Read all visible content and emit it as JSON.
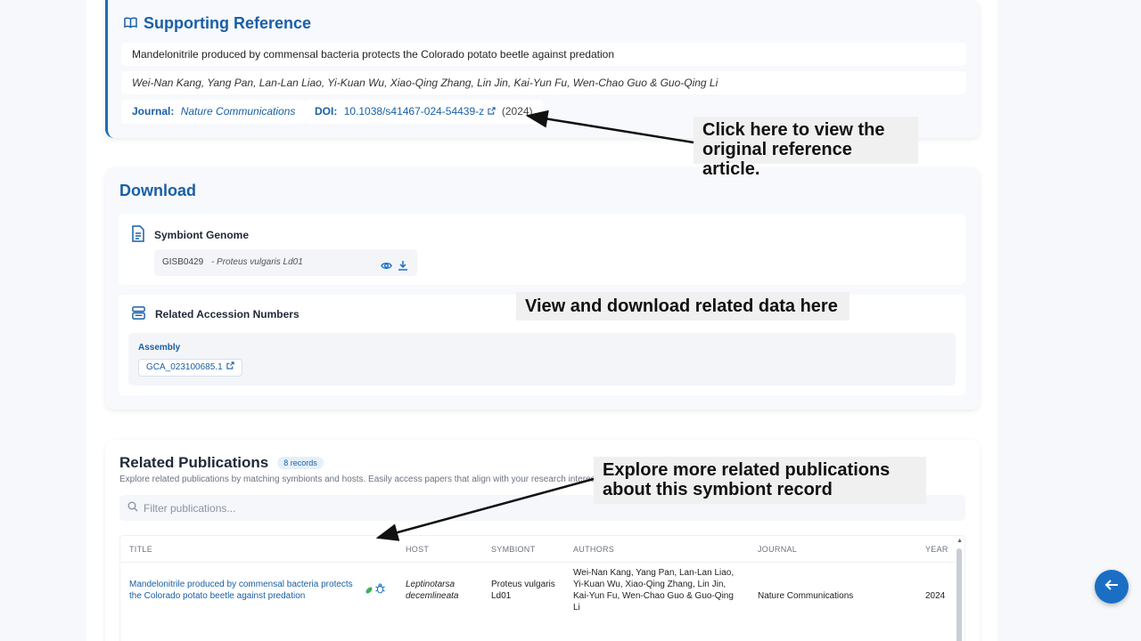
{
  "reference": {
    "heading": "Supporting Reference",
    "title": "Mandelonitrile produced by commensal bacteria protects the Colorado potato beetle against predation",
    "authors": "Wei-Nan Kang, Yang Pan, Lan-Lan Liao, Yi-Kuan Wu, Xiao-Qing Zhang, Lin Jin, Kai-Yun Fu, Wen-Chao Guo & Guo-Qing Li",
    "journal_label": "Journal:",
    "journal": "Nature Communications",
    "doi_label": "DOI:",
    "doi": "10.1038/s41467-024-54439-z",
    "year": "(2024)"
  },
  "download": {
    "heading": "Download",
    "genome": {
      "label": "Symbiont Genome",
      "id": "GISB0429",
      "name": "- Proteus vulgaris Ld01"
    },
    "accessions": {
      "label": "Related Accession Numbers",
      "assembly_label": "Assembly",
      "assembly_id": "GCA_023100685.1"
    }
  },
  "publications": {
    "heading": "Related Publications",
    "badge": "8 records",
    "description": "Explore related publications by matching symbionts and hosts. Easily access papers that align with your research interests.",
    "filter_placeholder": "Filter publications...",
    "columns": [
      "TITLE",
      "HOST",
      "SYMBIONT",
      "AUTHORS",
      "JOURNAL",
      "YEAR"
    ],
    "rows": [
      {
        "title": "Mandelonitrile produced by commensal bacteria protects the Colorado potato beetle against predation",
        "host": "Leptinotarsa decemlineata",
        "symbiont": "Proteus vulgaris Ld01",
        "authors": "Wei-Nan Kang, Yang Pan, Lan-Lan Liao, Yi-Kuan Wu, Xiao-Qing Zhang, Lin Jin, Kai-Yun Fu, Wen-Chao Guo & Guo-Qing Li",
        "journal": "Nature Communications",
        "year": "2024"
      }
    ]
  },
  "annotations": {
    "reference": "Click here to view the original reference article.",
    "download": "View and download related data here",
    "publications": "Explore more related publications about this symbiont record"
  },
  "colors": {
    "accent": "#1a5fa6",
    "annotation_bg": "#f0f0f0",
    "back_button": "#1a6fc4"
  },
  "icons": {
    "reference": "book-open-icon",
    "external": "external-link-icon",
    "genome": "document-icon",
    "accessions": "database-icon",
    "view": "eye-icon",
    "download": "download-icon",
    "search": "search-icon",
    "back": "arrow-left-icon"
  }
}
